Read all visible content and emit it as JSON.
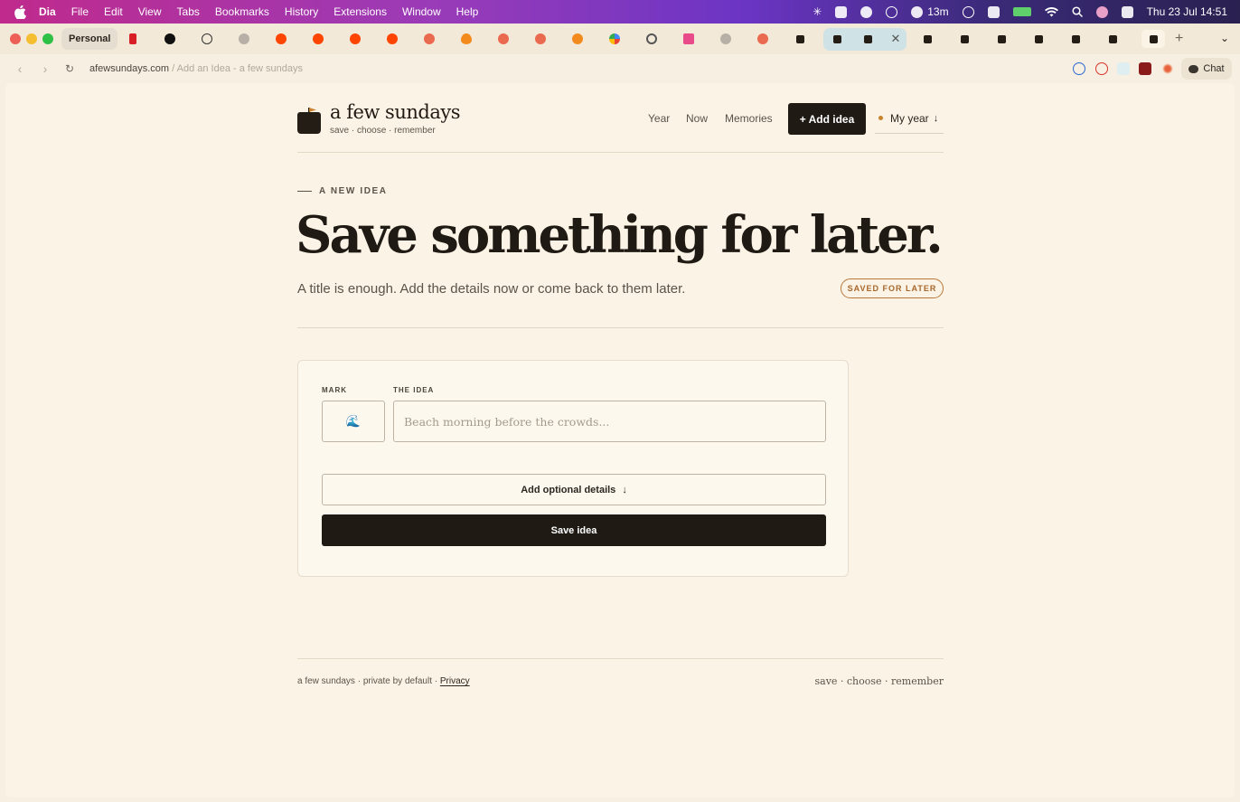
{
  "menubar": {
    "app": "Dia",
    "items": [
      "File",
      "Edit",
      "View",
      "Tabs",
      "Bookmarks",
      "History",
      "Extensions",
      "Window",
      "Help"
    ],
    "timer": "13m",
    "clock": "Thu 23 Jul  14:51"
  },
  "browser": {
    "profile": "Personal",
    "url_domain": "afewsundays.com",
    "url_rest": " / Add an Idea - a few sundays",
    "chat_label": "Chat",
    "new_tab": "+",
    "tab_menu": "⌄"
  },
  "site": {
    "brand": "a few sundays",
    "tagline": "save · choose · remember",
    "nav": [
      "Year",
      "Now",
      "Memories"
    ],
    "add_idea": "+ Add idea",
    "my_year": "My year",
    "my_year_arrow": "↓"
  },
  "hero": {
    "eyebrow": "A NEW IDEA",
    "headline": "Save something for later.",
    "subline": "A title is enough. Add the details now or come back to them later.",
    "badge": "SAVED FOR LATER"
  },
  "form": {
    "mark_label": "MARK",
    "idea_label": "THE IDEA",
    "mark_value": "🌊",
    "idea_placeholder": "Beach morning before the crowds...",
    "optional_label": "Add optional details",
    "optional_arrow": "↓",
    "save_label": "Save idea"
  },
  "footer": {
    "left": "a few sundays · private by default · ",
    "privacy": "Privacy",
    "right": "save · choose · remember"
  },
  "colors": {
    "accent": "#c8832e",
    "primary_button": "#1f1a14",
    "page_bg": "#fbf3e5"
  }
}
